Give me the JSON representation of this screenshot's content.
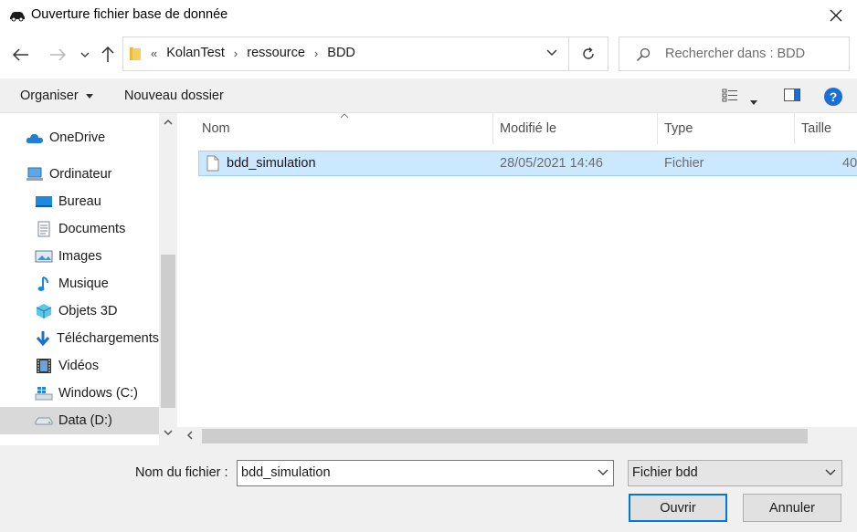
{
  "window": {
    "title": "Ouverture fichier base de donnée"
  },
  "address": {
    "overflow": "«",
    "crumbs": [
      "KolanTest",
      "ressource",
      "BDD"
    ],
    "separator": "›"
  },
  "search": {
    "placeholder": "Rechercher dans : BDD"
  },
  "toolbar": {
    "organize_label": "Organiser",
    "new_folder_label": "Nouveau dossier",
    "help_label": "?"
  },
  "sidebar": {
    "items": [
      {
        "label": "OneDrive",
        "icon": "cloud-icon"
      },
      {
        "label": "Ordinateur",
        "icon": "computer-icon"
      },
      {
        "label": "Bureau",
        "icon": "desktop-icon"
      },
      {
        "label": "Documents",
        "icon": "document-icon"
      },
      {
        "label": "Images",
        "icon": "picture-icon"
      },
      {
        "label": "Musique",
        "icon": "music-note-icon"
      },
      {
        "label": "Objets 3D",
        "icon": "cube-icon"
      },
      {
        "label": "Téléchargements",
        "icon": "download-arrow-icon"
      },
      {
        "label": "Vidéos",
        "icon": "film-icon"
      },
      {
        "label": "Windows (C:)",
        "icon": "windows-drive-icon"
      },
      {
        "label": "Data (D:)",
        "icon": "drive-icon",
        "selected": true
      }
    ]
  },
  "columns": [
    "Nom",
    "Modifié le",
    "Type",
    "Taille"
  ],
  "files": [
    {
      "name": "bdd_simulation",
      "modified": "28/05/2021 14:46",
      "type": "Fichier",
      "size": "40",
      "selected": true
    }
  ],
  "footer": {
    "filename_label": "Nom du fichier :",
    "filename_value": "bdd_simulation",
    "filter_value": "Fichier bdd",
    "open_label": "Ouvrir",
    "cancel_label": "Annuler"
  },
  "colors": {
    "selection_bg": "#cce8ff",
    "selection_border": "#99d1ff",
    "accent": "#0078d7",
    "help": "#1a6fd6"
  }
}
